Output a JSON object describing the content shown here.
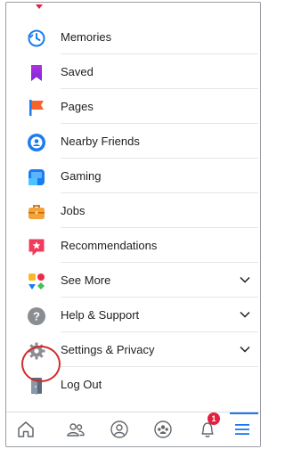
{
  "menu": {
    "items": [
      {
        "label": "Memories",
        "icon": "memories-clock-icon"
      },
      {
        "label": "Saved",
        "icon": "saved-bookmark-icon"
      },
      {
        "label": "Pages",
        "icon": "pages-flag-icon"
      },
      {
        "label": "Nearby Friends",
        "icon": "nearby-friends-icon"
      },
      {
        "label": "Gaming",
        "icon": "gaming-icon"
      },
      {
        "label": "Jobs",
        "icon": "jobs-briefcase-icon"
      },
      {
        "label": "Recommendations",
        "icon": "recommendations-star-icon"
      },
      {
        "label": "See More",
        "icon": "see-more-grid-icon"
      },
      {
        "label": "Help & Support",
        "icon": "help-question-icon"
      },
      {
        "label": "Settings & Privacy",
        "icon": "settings-gear-icon"
      },
      {
        "label": "Log Out",
        "icon": "log-out-door-icon"
      }
    ]
  },
  "tabbar": {
    "notifications_badge": "1"
  },
  "colors": {
    "accent": "#1877f2",
    "badge": "#e41e3f",
    "highlight_ring": "#d12b2b"
  }
}
